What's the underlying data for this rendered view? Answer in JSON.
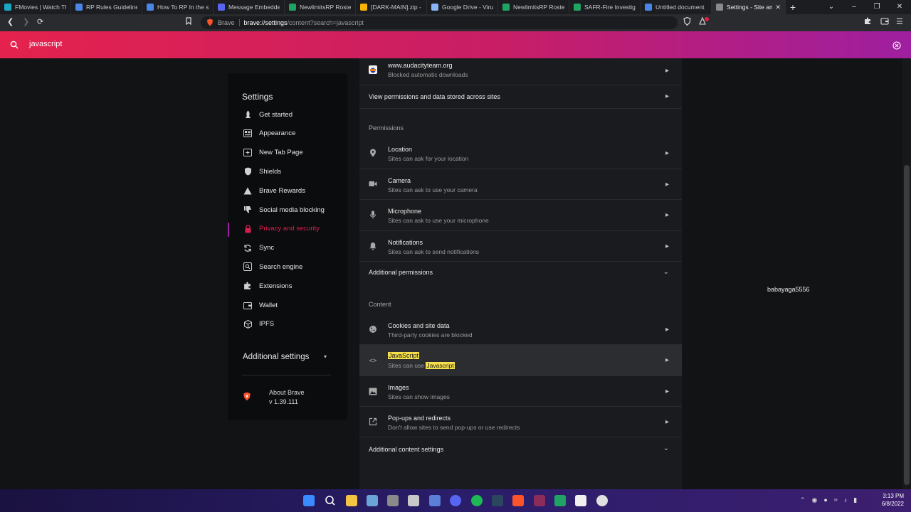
{
  "tabs": [
    {
      "title": "FMovies | Watch The",
      "color": "#1aa7c4"
    },
    {
      "title": "RP Rules Guidelines a",
      "color": "#4a86e8"
    },
    {
      "title": "How To RP In the serv",
      "color": "#4a86e8"
    },
    {
      "title": "Message Embedder",
      "color": "#5865f2"
    },
    {
      "title": "NewlimitsRP Roster",
      "color": "#1fa463"
    },
    {
      "title": "[DARK-MAIN].zip - G",
      "color": "#f4b400"
    },
    {
      "title": "Google Drive - Virus",
      "color": "#8ab4f8"
    },
    {
      "title": "NewlimitsRP Roster",
      "color": "#1fa463"
    },
    {
      "title": "SAFR-Fire Investigat",
      "color": "#1fa463"
    },
    {
      "title": "Untitled document",
      "color": "#4a86e8"
    },
    {
      "title": "Settings - Site an",
      "color": "#8a8a8a",
      "active": true
    }
  ],
  "toolbar": {
    "brand": "Brave",
    "url_host": "brave://settings",
    "url_path": "/content?search=javascript"
  },
  "search": {
    "query": "javascript"
  },
  "nav": {
    "header": "Settings",
    "items": [
      {
        "label": "Get started",
        "icon": "rocket-icon"
      },
      {
        "label": "Appearance",
        "icon": "appearance-icon"
      },
      {
        "label": "New Tab Page",
        "icon": "new-tab-icon"
      },
      {
        "label": "Shields",
        "icon": "shield-icon"
      },
      {
        "label": "Brave Rewards",
        "icon": "rewards-icon"
      },
      {
        "label": "Social media blocking",
        "icon": "thumbs-down-icon"
      },
      {
        "label": "Privacy and security",
        "icon": "lock-icon",
        "active": true
      },
      {
        "label": "Sync",
        "icon": "sync-icon"
      },
      {
        "label": "Search engine",
        "icon": "search-engine-icon"
      },
      {
        "label": "Extensions",
        "icon": "puzzle-icon"
      },
      {
        "label": "Wallet",
        "icon": "wallet-icon"
      },
      {
        "label": "IPFS",
        "icon": "ipfs-icon"
      }
    ],
    "additional": "Additional settings",
    "about": "About Brave",
    "version": "v 1.39.111"
  },
  "content": {
    "site_row": {
      "title": "www.audacityteam.org",
      "sub": "Blocked automatic downloads"
    },
    "view_permissions": "View permissions and data stored across sites",
    "permissions_header": "Permissions",
    "permissions": [
      {
        "title": "Location",
        "sub": "Sites can ask for your location",
        "icon": "location-icon"
      },
      {
        "title": "Camera",
        "sub": "Sites can ask to use your camera",
        "icon": "camera-icon"
      },
      {
        "title": "Microphone",
        "sub": "Sites can ask to use your microphone",
        "icon": "microphone-icon"
      },
      {
        "title": "Notifications",
        "sub": "Sites can ask to send notifications",
        "icon": "bell-icon"
      }
    ],
    "additional_permissions": "Additional permissions",
    "content_header": "Content",
    "cookies": {
      "title": "Cookies and site data",
      "sub": "Third-party cookies are blocked"
    },
    "javascript": {
      "title": "JavaScript",
      "sub_prefix": "Sites can use ",
      "sub_hl": "Javascript"
    },
    "images": {
      "title": "Images",
      "sub": "Sites can show images"
    },
    "popups": {
      "title": "Pop-ups and redirects",
      "sub": "Don't allow sites to send pop-ups or use redirects"
    },
    "additional_content": "Additional content settings"
  },
  "watermark": "babayaga5556",
  "clock": {
    "time": "3:13 PM",
    "date": "6/8/2022"
  },
  "colors": {
    "accent": "#d6204f",
    "highlight": "#f7e14b"
  }
}
